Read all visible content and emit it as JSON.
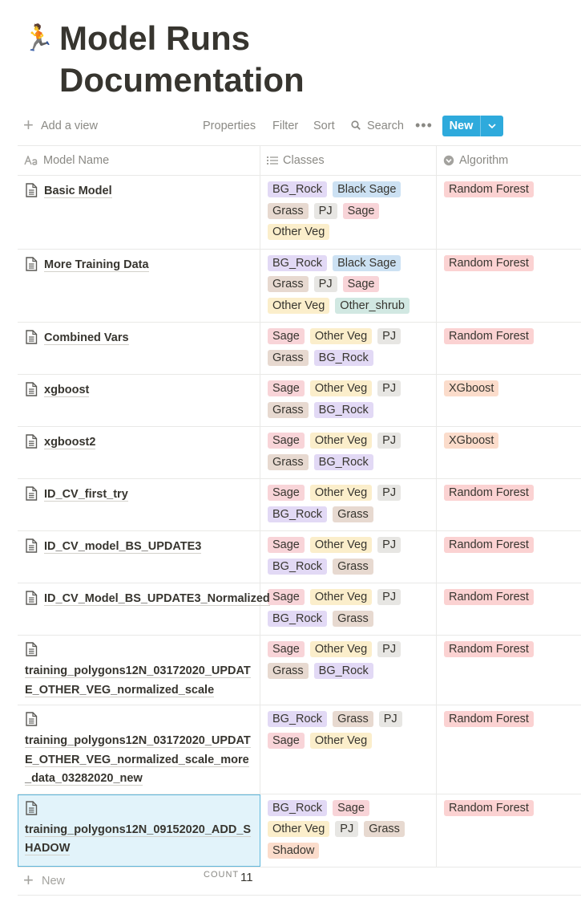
{
  "page": {
    "icon": "runner-emoji",
    "icon_glyph": "🏃",
    "title": "Model Runs Documentation"
  },
  "toolbar": {
    "add_view": "Add a view",
    "properties": "Properties",
    "filter": "Filter",
    "sort": "Sort",
    "search": "Search",
    "more": "•••",
    "new_button": "New"
  },
  "columns": {
    "name": "Model Name",
    "classes": "Classes",
    "algorithm": "Algorithm"
  },
  "tag_colors": {
    "BG_Rock": "#e2d9f5",
    "Black Sage": "#cce1f3",
    "Grass": "#e7d9d0",
    "PJ": "#e7e6e3",
    "Sage": "#f8d4d8",
    "Other Veg": "#fbeecb",
    "Other_shrub": "#d1e8e2",
    "Shadow": "#fbdccb",
    "Random Forest": "#fbd2d2",
    "XGboost": "#fbdccb"
  },
  "rows": [
    {
      "name": "Basic Model",
      "classes": [
        "BG_Rock",
        "Black Sage",
        "Grass",
        "PJ",
        "Sage",
        "Other Veg"
      ],
      "algorithm": "Random Forest"
    },
    {
      "name": "More Training Data",
      "classes": [
        "BG_Rock",
        "Black Sage",
        "Grass",
        "PJ",
        "Sage",
        "Other Veg",
        "Other_shrub"
      ],
      "algorithm": "Random Forest"
    },
    {
      "name": "Combined Vars",
      "classes": [
        "Sage",
        "Other Veg",
        "PJ",
        "Grass",
        "BG_Rock"
      ],
      "algorithm": "Random Forest"
    },
    {
      "name": "xgboost",
      "classes": [
        "Sage",
        "Other Veg",
        "PJ",
        "Grass",
        "BG_Rock"
      ],
      "algorithm": "XGboost"
    },
    {
      "name": "xgboost2",
      "classes": [
        "Sage",
        "Other Veg",
        "PJ",
        "Grass",
        "BG_Rock"
      ],
      "algorithm": "XGboost"
    },
    {
      "name": "ID_CV_first_try",
      "classes": [
        "Sage",
        "Other Veg",
        "PJ",
        "BG_Rock",
        "Grass"
      ],
      "algorithm": "Random Forest"
    },
    {
      "name": "ID_CV_model_BS_UPDATE3",
      "classes": [
        "Sage",
        "Other Veg",
        "PJ",
        "BG_Rock",
        "Grass"
      ],
      "algorithm": "Random Forest"
    },
    {
      "name": "ID_CV_Model_BS_UPDATE3_Normalized",
      "classes": [
        "Sage",
        "Other Veg",
        "PJ",
        "BG_Rock",
        "Grass"
      ],
      "algorithm": "Random Forest"
    },
    {
      "name": "training_polygons12N_03172020_UPDATE_OTHER_VEG_normalized_scale",
      "classes": [
        "Sage",
        "Other Veg",
        "PJ",
        "Grass",
        "BG_Rock"
      ],
      "algorithm": "Random Forest"
    },
    {
      "name": "training_polygons12N_03172020_UPDATE_OTHER_VEG_normalized_scale_more_data_03282020_new",
      "classes": [
        "BG_Rock",
        "Grass",
        "PJ",
        "Sage",
        "Other Veg"
      ],
      "algorithm": "Random Forest"
    },
    {
      "name": "training_polygons12N_09152020_ADD_SHADOW",
      "classes": [
        "BG_Rock",
        "Sage",
        "Other Veg",
        "PJ",
        "Grass",
        "Shadow"
      ],
      "algorithm": "Random Forest",
      "selected": true
    }
  ],
  "footer": {
    "new_row": "New",
    "count_label": "COUNT",
    "count_value": "11"
  }
}
